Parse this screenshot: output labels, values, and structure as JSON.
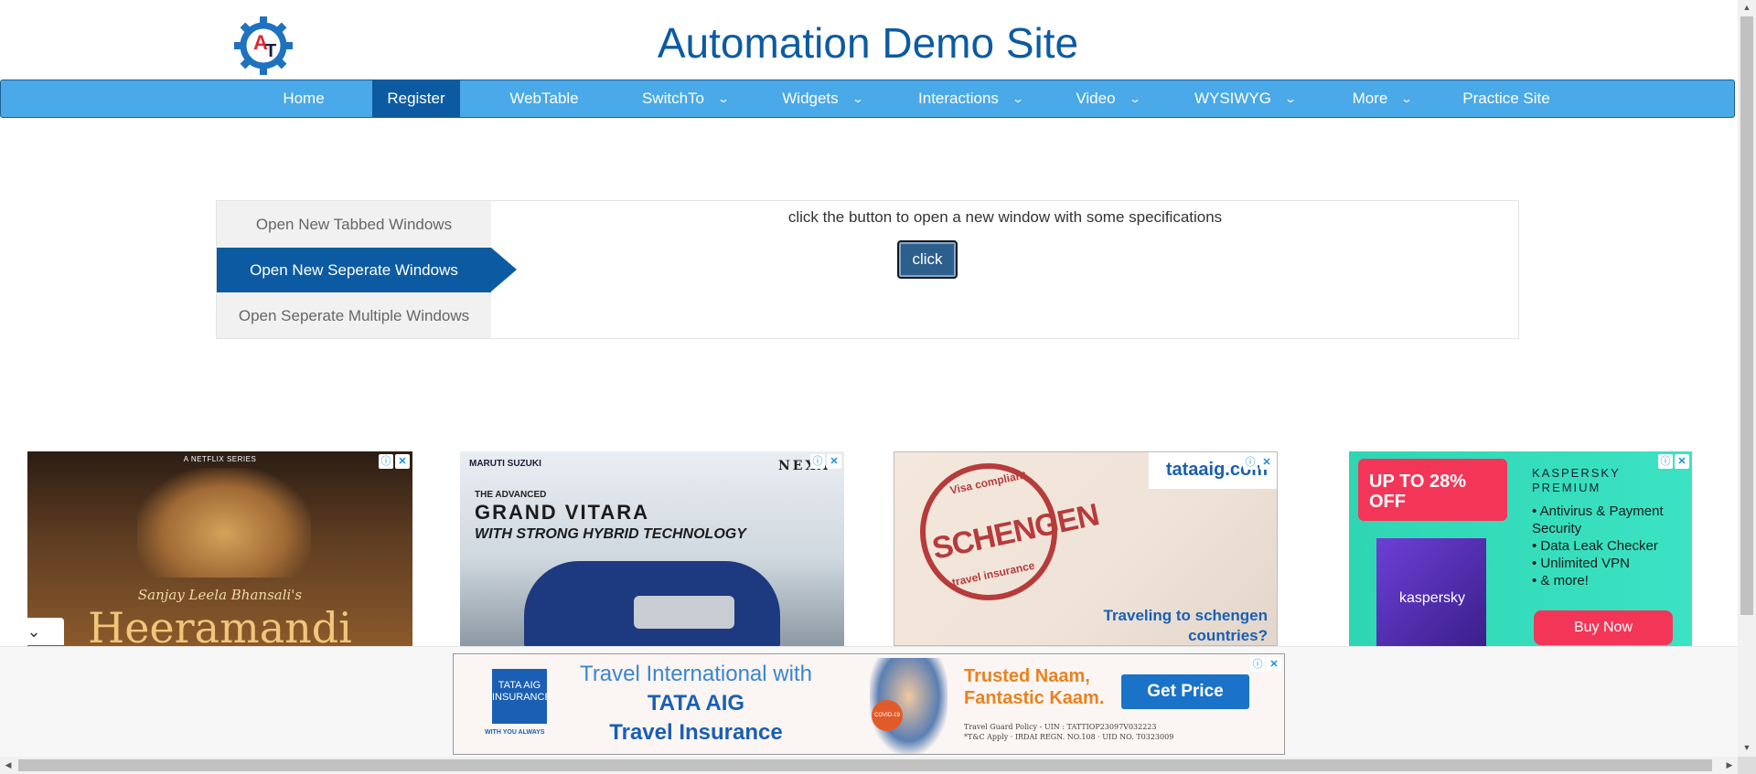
{
  "header": {
    "title": "Automation Demo Site",
    "logo_text": "AT"
  },
  "nav": {
    "items": [
      {
        "label": "Home",
        "active": false,
        "dropdown": false
      },
      {
        "label": "Register",
        "active": true,
        "dropdown": false
      },
      {
        "label": "WebTable",
        "active": false,
        "dropdown": false
      },
      {
        "label": "SwitchTo",
        "active": false,
        "dropdown": true
      },
      {
        "label": "Widgets",
        "active": false,
        "dropdown": true
      },
      {
        "label": "Interactions",
        "active": false,
        "dropdown": true
      },
      {
        "label": "Video",
        "active": false,
        "dropdown": true
      },
      {
        "label": "WYSIWYG",
        "active": false,
        "dropdown": true
      },
      {
        "label": "More",
        "active": false,
        "dropdown": true
      },
      {
        "label": "Practice Site",
        "active": false,
        "dropdown": false
      }
    ],
    "caret": "⌄"
  },
  "tabs": {
    "items": [
      {
        "label": "Open New Tabbed Windows",
        "active": false
      },
      {
        "label": "Open New Seperate Windows",
        "active": true
      },
      {
        "label": "Open Seperate Multiple Windows",
        "active": false
      }
    ],
    "content_text": "click the button to open a new window with some specifications",
    "button_label": "click"
  },
  "ads": {
    "ad1": {
      "badge": "A NETFLIX SERIES",
      "byline": "Sanjay Leela Bhansali's",
      "title": "Heeramandi"
    },
    "ad2": {
      "brand": "MARUTI SUZUKI",
      "nexa": "NEXA",
      "advanced": "THE ADVANCED",
      "model": "GRAND VITARA",
      "tech": "WITH STRONG HYBRID TECHNOLOGY"
    },
    "ad3": {
      "logo": "tataaig.com",
      "stamp_top": "Visa compliant",
      "stamp_word": "SCHENGEN",
      "stamp_bottom": "travel insurance",
      "tagline": "Traveling to schengen countries?"
    },
    "ad4": {
      "offer": "UP TO 28% OFF",
      "product_title": "KASPERSKY PREMIUM",
      "features": [
        "Antivirus & Payment Security",
        "Data Leak Checker",
        "Unlimited VPN",
        "& more!"
      ],
      "box_label": "kaspersky",
      "cta": "Buy Now"
    },
    "info_icon": "ⓘ",
    "close_icon": "✕"
  },
  "bottom_ad": {
    "logo_text": "TATA AIG INSURANCE",
    "logo_sub": "WITH YOU ALWAYS",
    "headline_1": "Travel International with",
    "headline_2": "TATA AIG",
    "headline_3": "Travel Insurance",
    "trusted_1": "Trusted Naam,",
    "trusted_2": "Fantastic Kaam.",
    "cta": "Get Price",
    "fine_1": "Travel Guard Policy - UIN : TATTIOP23097V032223",
    "fine_2": "*T&C Apply  ·  IRDAI REGN. NO.108  ·  UID NO. T0323009",
    "covid": "COVID-19"
  },
  "collapse_icon": "⌄",
  "colors": {
    "nav_bg": "#4aa9e8",
    "nav_active": "#0c5ba2",
    "title": "#0c5ba2"
  }
}
